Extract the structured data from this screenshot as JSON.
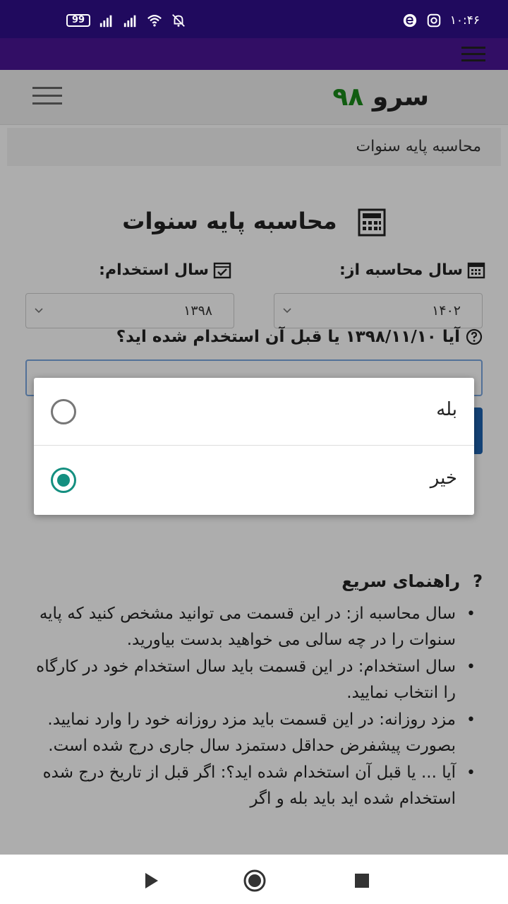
{
  "status_bar": {
    "battery": "99",
    "time": "۱۰:۴۶",
    "icons": [
      "battery-icon",
      "signal-icon",
      "signal-icon",
      "wifi-icon",
      "bell-off-icon",
      "e-app-icon",
      "instagram-icon"
    ]
  },
  "header": {
    "logo_text": "سرو",
    "logo_number": "۹۸"
  },
  "breadcrumb": "محاسبه پایه سنوات",
  "page_title": "محاسبه پایه سنوات",
  "form": {
    "calc_year_label": "سال محاسبه از:",
    "calc_year_value": "۱۴۰۲",
    "hire_year_label": "سال استخدام:",
    "hire_year_value": "۱۳۹۸",
    "question": "آیا ۱۳۹۸/۱۱/۱۰ یا قبل آن استخدام شده اید؟"
  },
  "dialog": {
    "options": [
      {
        "label": "بله",
        "selected": false
      },
      {
        "label": "خیر",
        "selected": true
      }
    ]
  },
  "guide": {
    "title": "راهنمای سریع",
    "items": [
      "سال محاسبه از: در این قسمت می توانید مشخص کنید که پایه سنوات را در چه سالی می خواهید بدست بیاورید.",
      "سال استخدام: در این قسمت باید سال استخدام خود در کارگاه را انتخاب نمایید.",
      "مزد روزانه: در این قسمت باید مزد روزانه خود را وارد نمایید. بصورت پیشفرض حداقل دستمزد سال جاری درج شده است.",
      "آیا ... یا قبل آن استخدام شده اید؟: اگر قبل از تاریخ درج شده استخدام شده اید باید بله و اگر"
    ]
  },
  "colors": {
    "status_bar": "#200a5e",
    "app_bar": "#4a1596",
    "logo_accent": "#1a8a1a",
    "radio_selected": "#148f80"
  }
}
